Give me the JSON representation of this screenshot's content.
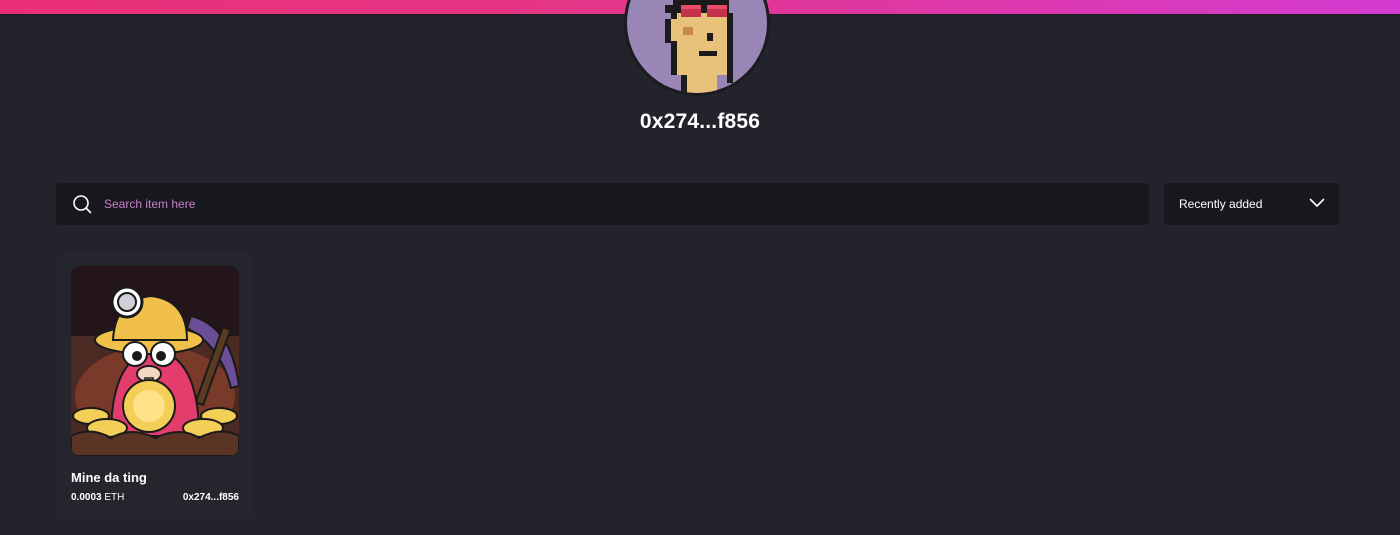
{
  "profile": {
    "address": "0x274...f856",
    "avatar_icon": "pixel-punk-avatar"
  },
  "search": {
    "placeholder": "Search item here",
    "value": "",
    "icon": "search-icon"
  },
  "sort": {
    "selected": "Recently added",
    "icon": "chevron-down-icon"
  },
  "items": [
    {
      "title": "Mine da ting",
      "price_value": "0.0003",
      "price_unit": "ETH",
      "owner": "0x274...f856",
      "image_icon": "miner-mole-artwork"
    }
  ],
  "colors": {
    "background": "#23242b",
    "banner_start": "#ea2f77",
    "banner_end": "#d43bd1",
    "placeholder": "#c77fc9",
    "panel": "#17181d"
  }
}
